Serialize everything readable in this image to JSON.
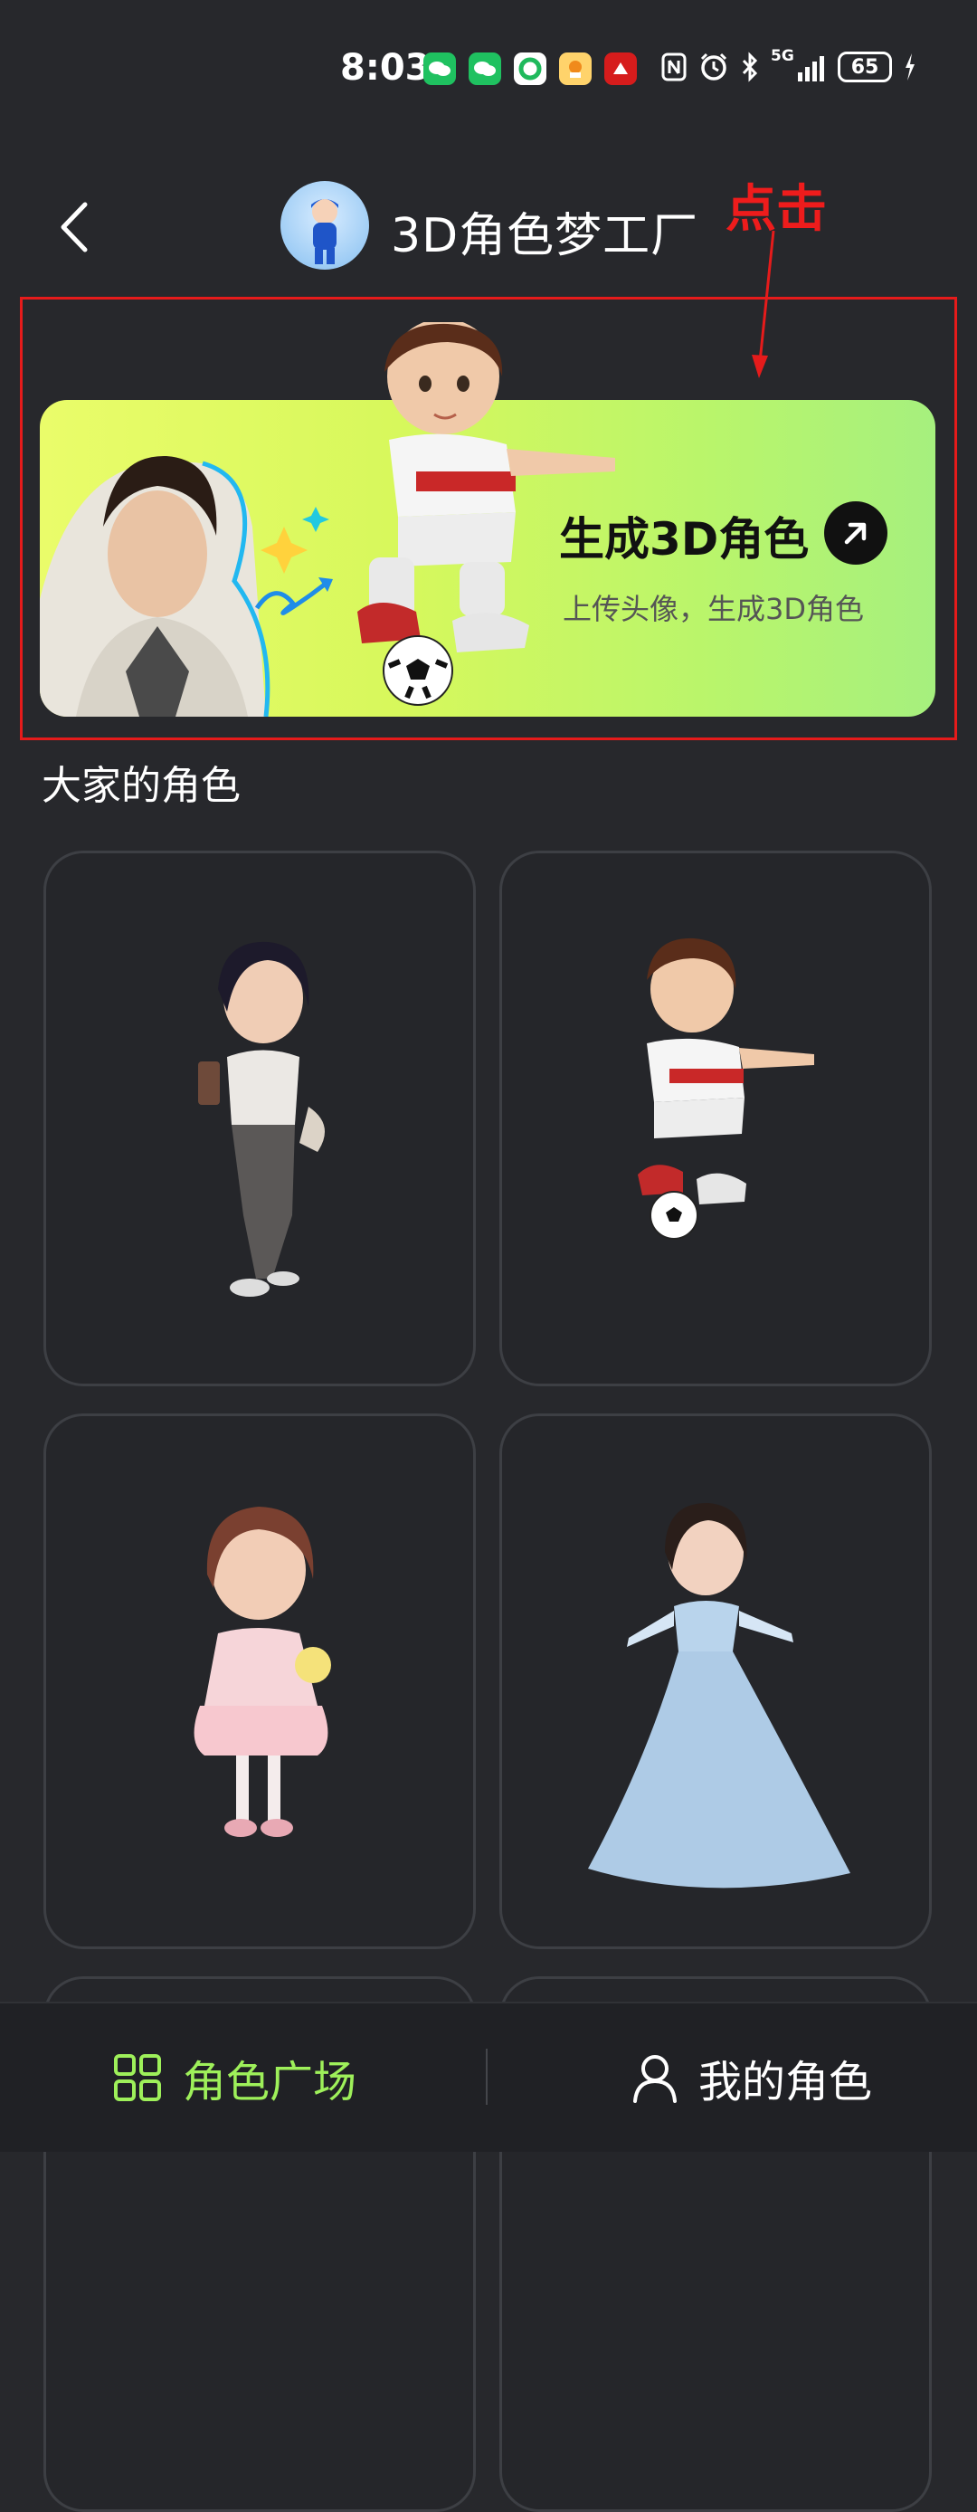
{
  "status_bar": {
    "time": "8:03",
    "network": "5G",
    "battery": "65"
  },
  "header": {
    "title": "3D角色梦工厂"
  },
  "annotation": {
    "label": "点击",
    "color": "#e51b1b"
  },
  "banner": {
    "title": "生成3D角色",
    "subtitle": "上传头像，生成3D角色"
  },
  "section": {
    "title": "大家的角色"
  },
  "characters": [
    {
      "name": "girl-with-coffee"
    },
    {
      "name": "boy-soccer-player"
    },
    {
      "name": "girl-with-toy"
    },
    {
      "name": "princess-blue-dress"
    }
  ],
  "bottom_nav": {
    "tab1_label": "角色广场",
    "tab2_label": "我的角色",
    "active_color": "#9ef05a"
  }
}
